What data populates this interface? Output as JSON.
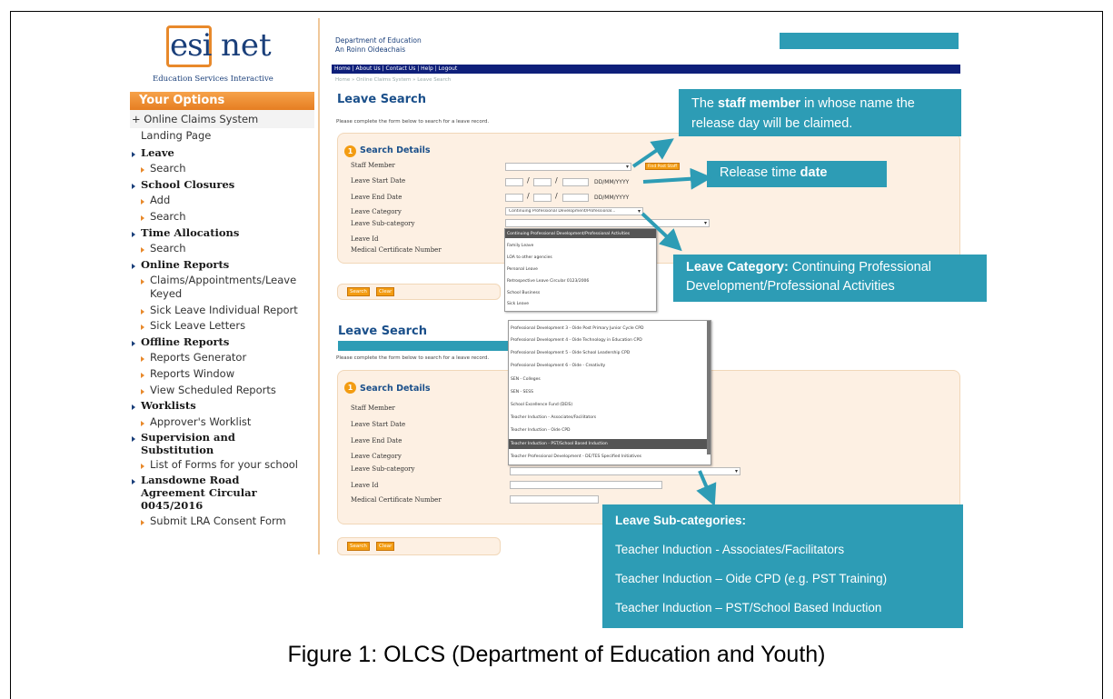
{
  "logo": {
    "left": "esi",
    "right": "net",
    "subtitle": "Education Services Interactive"
  },
  "header": {
    "dept_line1": "Department of Education",
    "dept_line2": "An Roinn Oideachais",
    "nav": "Home | About Us | Contact Us | Help | Logout",
    "breadcrumb": "Home » Online Claims System » Leave Search"
  },
  "sidebar": {
    "title": "Your Options",
    "items": [
      {
        "label": "+ Online Claims System",
        "type": "section"
      },
      {
        "label": "Landing Page",
        "type": "link"
      },
      {
        "label": "Leave",
        "type": "heading"
      },
      {
        "label": "Search",
        "type": "sub"
      },
      {
        "label": "School Closures",
        "type": "heading"
      },
      {
        "label": "Add",
        "type": "sub"
      },
      {
        "label": "Search",
        "type": "sub"
      },
      {
        "label": "Time Allocations",
        "type": "heading"
      },
      {
        "label": "Search",
        "type": "sub"
      },
      {
        "label": "Online Reports",
        "type": "heading"
      },
      {
        "label": "Claims/Appointments/Leave",
        "type": "sub"
      },
      {
        "label": "Keyed",
        "type": "cont"
      },
      {
        "label": "Sick Leave Individual Report",
        "type": "sub"
      },
      {
        "label": "Sick Leave Letters",
        "type": "sub"
      },
      {
        "label": "Offline Reports",
        "type": "heading"
      },
      {
        "label": "Reports Generator",
        "type": "sub"
      },
      {
        "label": "Reports Window",
        "type": "sub"
      },
      {
        "label": "View Scheduled Reports",
        "type": "sub"
      },
      {
        "label": "Worklists",
        "type": "heading"
      },
      {
        "label": "Approver's Worklist",
        "type": "sub"
      },
      {
        "label": "Supervision and",
        "type": "heading"
      },
      {
        "label": "Substitution",
        "type": "headcont"
      },
      {
        "label": "List of Forms for your school",
        "type": "sub"
      },
      {
        "label": "Lansdowne Road",
        "type": "heading"
      },
      {
        "label": "Agreement Circular",
        "type": "headcont"
      },
      {
        "label": "0045/2016",
        "type": "headcont"
      },
      {
        "label": "Submit LRA Consent Form",
        "type": "sub"
      }
    ]
  },
  "search1": {
    "title": "Leave Search",
    "intro": "Please complete the form below to search for a leave record.",
    "section": "Search Details",
    "section_num": "1",
    "labels": {
      "staff": "Staff Member",
      "start": "Leave Start Date",
      "end": "Leave End Date",
      "category": "Leave Category",
      "subcategory": "Leave Sub-category",
      "id": "Leave Id",
      "medcert": "Medical Certificate Number"
    },
    "date_format": "DD/MM/YYYY",
    "find_post": "Find Post Staff",
    "category_value": "Continuing Professional Development/Professional...",
    "buttons": {
      "search": "Search",
      "clear": "Clear"
    },
    "category_options": [
      "Continuing Professional Development/Professional Activities",
      "Family Leave",
      "LOA to other agencies",
      "Personal Leave",
      "Retrospective Leave Circular 0123/2006",
      "School Business",
      "Sick Leave"
    ]
  },
  "search2": {
    "title": "Leave Search",
    "intro": "Please complete the form below to search for a leave record.",
    "section": "Search Details",
    "section_num": "1",
    "labels": {
      "staff": "Staff Member",
      "start": "Leave Start Date",
      "end": "Leave End Date",
      "category": "Leave Category",
      "subcategory": "Leave Sub-category",
      "id": "Leave Id",
      "medcert": "Medical Certificate Number"
    },
    "buttons": {
      "search": "Search",
      "clear": "Clear"
    },
    "subcategory_value": "Teacher Professional Development - DE/TES Specified Initiatives",
    "subcategory_options": [
      "Professional Development 3 - Oide Post Primary Junior Cycle CPD",
      "Professional Development 4 - Oide Technology in Education CPD",
      "Professional Development 5 - Oide School Leadership CPD",
      "Professional Development 6 - Oide - Creativity",
      "SEN - Colleges",
      "SEN - SESS",
      "School Excellence Fund (DEIS)",
      "Teacher Induction - Associates/Facilitators",
      "Teacher Induction - Oide CPD",
      "Teacher Induction - PST/School Based Induction",
      "Teacher Professional Development - DE/TES Specified Initiatives"
    ]
  },
  "callouts": {
    "staff_pre": "The ",
    "staff_bold": "staff member",
    "staff_post": " in whose name the",
    "staff_line2": "release day will be claimed.",
    "date_pre": "Release time ",
    "date_bold": "date",
    "cat_bold": "Leave Category:",
    "cat_text": " Continuing Professional",
    "cat_line2": "Development/Professional Activities",
    "sub_title": "Leave Sub-categories:",
    "sub_1": "Teacher Induction - Associates/Facilitators",
    "sub_2": "Teacher Induction – Oide CPD (e.g. PST Training)",
    "sub_3": "Teacher Induction – PST/School Based Induction"
  },
  "caption": "Figure 1: OLCS (Department of Education and Youth)",
  "colors": {
    "teal": "#2d9cb5",
    "orange": "#f39c12",
    "navy": "#0e1f7a",
    "panel": "#fdf0e3"
  }
}
